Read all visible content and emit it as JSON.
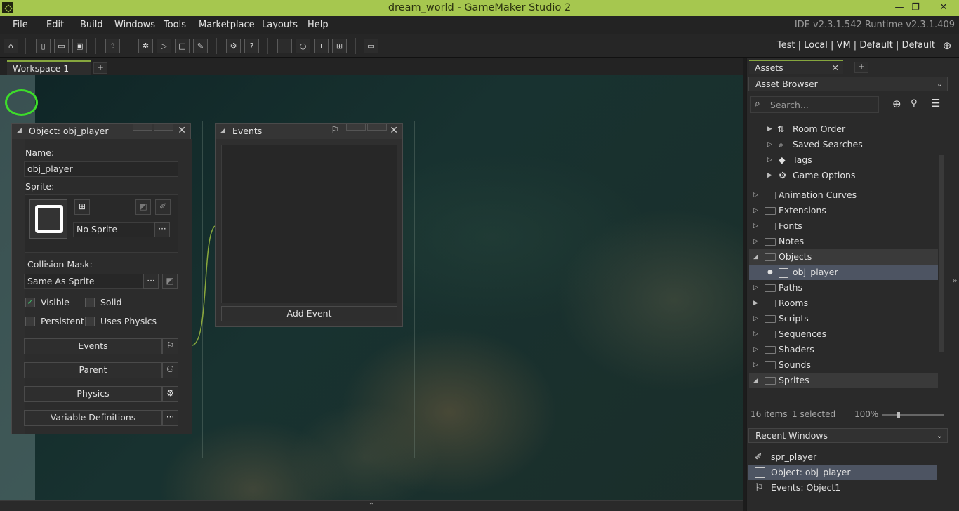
{
  "window": {
    "title": "dream_world - GameMaker Studio 2",
    "minimize": "—",
    "maximize": "❐",
    "close": "✕"
  },
  "menu": {
    "items": [
      "File",
      "Edit",
      "Build",
      "Windows",
      "Tools",
      "Marketplace",
      "Layouts",
      "Help"
    ],
    "version": "IDE v2.3.1.542  Runtime v2.3.1.409"
  },
  "toolbar": {
    "targets": [
      "Test",
      "Local",
      "VM",
      "Default",
      "Default"
    ],
    "separator": "|"
  },
  "workspace": {
    "tabs": [
      "Workspace 1"
    ],
    "add_tab": "+"
  },
  "object_editor": {
    "title": "Object: obj_player",
    "name_label": "Name:",
    "name_value": "obj_player",
    "sprite_label": "Sprite:",
    "sprite_value": "No Sprite",
    "more": "···",
    "collision_label": "Collision Mask:",
    "collision_value": "Same As Sprite",
    "checkboxes": [
      {
        "label": "Visible",
        "checked": true
      },
      {
        "label": "Solid",
        "checked": false
      },
      {
        "label": "Persistent",
        "checked": false
      },
      {
        "label": "Uses Physics",
        "checked": false
      }
    ],
    "buttons": [
      "Events",
      "Parent",
      "Physics",
      "Variable Definitions"
    ]
  },
  "events_panel": {
    "title": "Events",
    "add_event": "Add Event"
  },
  "assets": {
    "tab": "Assets",
    "add_tab": "+",
    "browser_label": "Asset Browser",
    "search_placeholder": "Search...",
    "special_items": [
      "Room Order",
      "Saved Searches",
      "Tags",
      "Game Options"
    ],
    "folders": [
      {
        "label": "Animation Curves",
        "expanded": false
      },
      {
        "label": "Extensions",
        "expanded": false
      },
      {
        "label": "Fonts",
        "expanded": false
      },
      {
        "label": "Notes",
        "expanded": false
      },
      {
        "label": "Objects",
        "expanded": true
      },
      {
        "label": "obj_player",
        "child": true
      },
      {
        "label": "Paths",
        "expanded": false
      },
      {
        "label": "Rooms",
        "expanded": false
      },
      {
        "label": "Scripts",
        "expanded": false
      },
      {
        "label": "Sequences",
        "expanded": false
      },
      {
        "label": "Shaders",
        "expanded": false
      },
      {
        "label": "Sounds",
        "expanded": false
      },
      {
        "label": "Sprites",
        "expanded": true
      }
    ],
    "status_items": "16 items",
    "status_selected": "1 selected",
    "zoom": "100%",
    "recent_label": "Recent Windows",
    "recent": [
      "spr_player",
      "Object: obj_player",
      "Events: Object1"
    ]
  },
  "colors": {
    "accent": "#a6c74f",
    "highlight": "#3ddc2a",
    "selection": "#4d5462"
  }
}
